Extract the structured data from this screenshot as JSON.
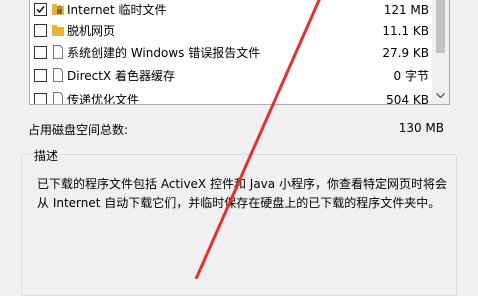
{
  "file_list": {
    "items": [
      {
        "name": "Internet 临时文件",
        "size": "121 MB",
        "checked": true,
        "icon": "lock-folder-icon"
      },
      {
        "name": "脱机网页",
        "size": "11.1 KB",
        "checked": false,
        "icon": "folder-icon"
      },
      {
        "name": "系统创建的 Windows 错误报告文件",
        "size": "27.9 KB",
        "checked": false,
        "icon": "file-icon"
      },
      {
        "name": "DirectX 着色器缓存",
        "size": "0 字节",
        "checked": false,
        "icon": "file-icon"
      },
      {
        "name": "传递优化文件",
        "size": "504 KB",
        "checked": false,
        "icon": "file-icon"
      }
    ]
  },
  "total": {
    "label": "占用磁盘空间总数:",
    "value": "130 MB"
  },
  "description": {
    "title": "描述",
    "text": "已下载的程序文件包括 ActiveX 控件和 Java 小程序，你查看特定网页时将会从 Internet 自动下载它们，并临时保存在硬盘上的已下载的程序文件夹中。"
  },
  "colors": {
    "annotation_arrow": "#e8302a",
    "folder": "#e8b632"
  }
}
